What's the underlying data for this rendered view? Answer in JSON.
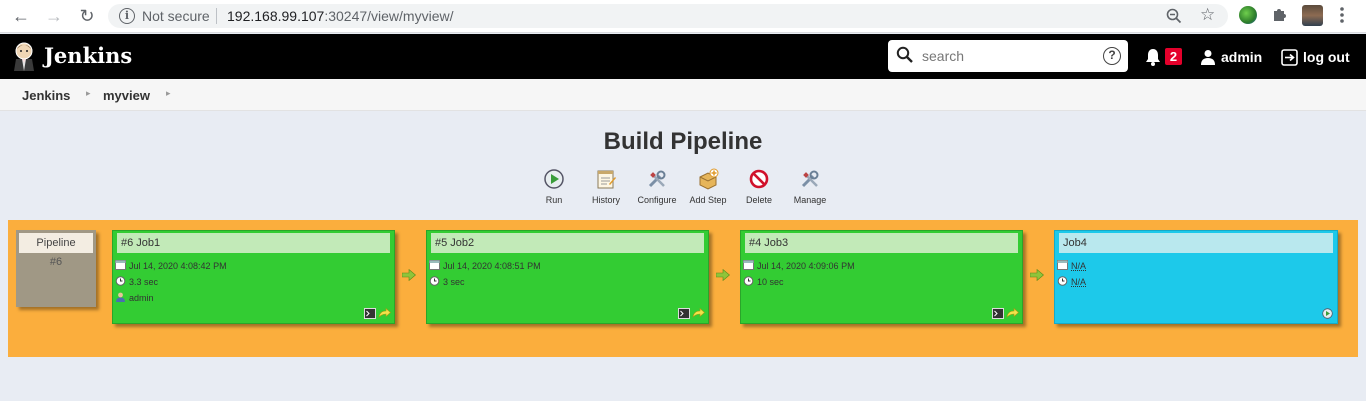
{
  "browser": {
    "not_secure": "Not secure",
    "url_host": "192.168.99.107",
    "url_path": ":30247/view/myview/"
  },
  "header": {
    "logo": "Jenkins",
    "search_placeholder": "search",
    "notification_count": "2",
    "user": "admin",
    "logout": "log out"
  },
  "breadcrumb": {
    "items": [
      "Jenkins",
      "myview"
    ]
  },
  "page": {
    "title": "Build Pipeline"
  },
  "toolbar": {
    "run": "Run",
    "history": "History",
    "configure": "Configure",
    "add_step": "Add Step",
    "delete": "Delete",
    "manage": "Manage"
  },
  "pipeline": {
    "label": "Pipeline",
    "number": "#6"
  },
  "jobs": [
    {
      "title": "#6 Job1",
      "date": "Jul 14, 2020 4:08:42 PM",
      "duration": "3.3 sec",
      "user": "admin",
      "status": "success",
      "color": "#33cc33"
    },
    {
      "title": "#5 Job2",
      "date": "Jul 14, 2020 4:08:51 PM",
      "duration": "3 sec",
      "status": "success",
      "color": "#33cc33"
    },
    {
      "title": "#4 Job3",
      "date": "Jul 14, 2020 4:09:06 PM",
      "duration": "10 sec",
      "status": "success",
      "color": "#33cc33"
    },
    {
      "title": "Job4",
      "date": "N/A",
      "duration": "N/A",
      "status": "pending",
      "color": "#1dc9ea"
    }
  ],
  "colors": {
    "band": "#fbae3d",
    "success": "#33cc33",
    "pending": "#1dc9ea",
    "badge": "#e4002b"
  }
}
